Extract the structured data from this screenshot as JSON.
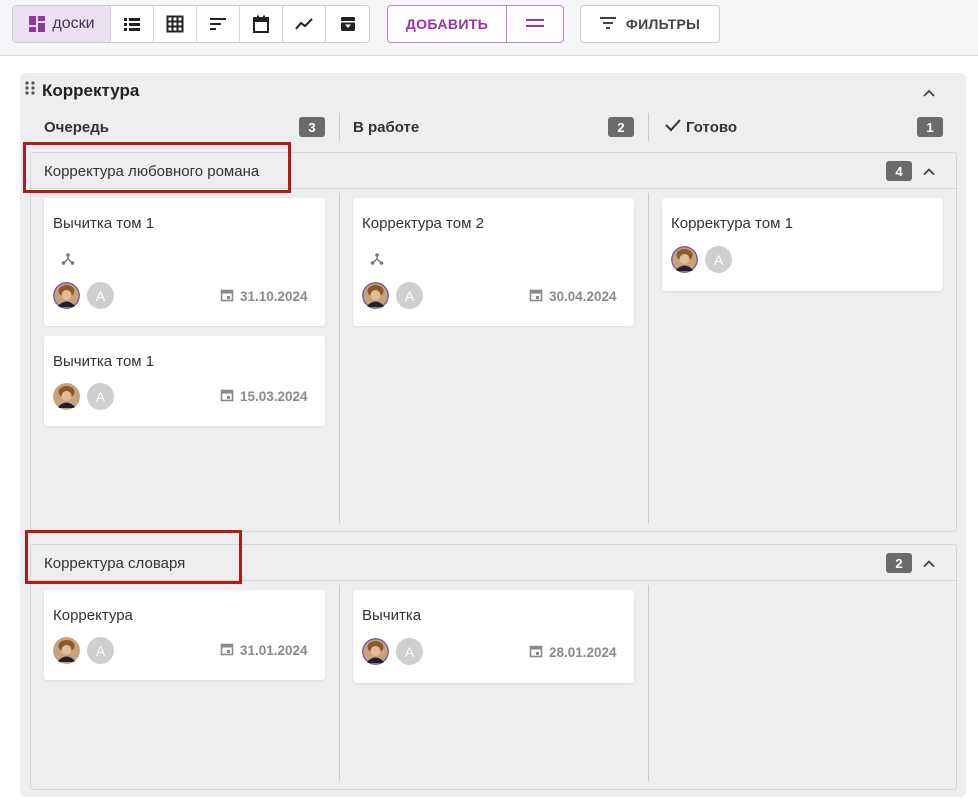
{
  "toolbar": {
    "views": [
      {
        "name": "boards",
        "label": "доски",
        "active": true
      },
      {
        "name": "list"
      },
      {
        "name": "table"
      },
      {
        "name": "gantt"
      },
      {
        "name": "calendar"
      },
      {
        "name": "chart"
      },
      {
        "name": "archive"
      }
    ],
    "add_label": "ДОБАВИТЬ",
    "filters_label": "ФИЛЬТРЫ"
  },
  "board": {
    "title": "Корректура",
    "columns": [
      {
        "name": "Очередь",
        "count": "3"
      },
      {
        "name": "В работе",
        "count": "2"
      },
      {
        "name": "Готово",
        "count": "1"
      }
    ],
    "lanes": [
      {
        "title": "Корректура любовного романа",
        "count": "4",
        "cards": [
          {
            "title": "Вычитка том 1",
            "date": "31.10.2024",
            "avatar_letter": "A"
          },
          {
            "title": "Вычитка том 1",
            "date": "15.03.2024",
            "avatar_letter": "A"
          },
          {
            "title": "Корректура том 2",
            "date": "30.04.2024",
            "avatar_letter": "A"
          },
          {
            "title": "Корректура том 1",
            "avatar_letter": "A"
          }
        ]
      },
      {
        "title": "Корректура словаря",
        "count": "2",
        "cards": [
          {
            "title": "Корректура",
            "date": "31.01.2024",
            "avatar_letter": "A"
          },
          {
            "title": "Вычитка",
            "date": "28.01.2024",
            "avatar_letter": "A"
          }
        ]
      }
    ]
  },
  "colors": {
    "accent": "#9c2fb0",
    "active_view_bg": "#ebe2f1",
    "highlight": "#b01c1c",
    "badge": "#6b6b6b"
  }
}
